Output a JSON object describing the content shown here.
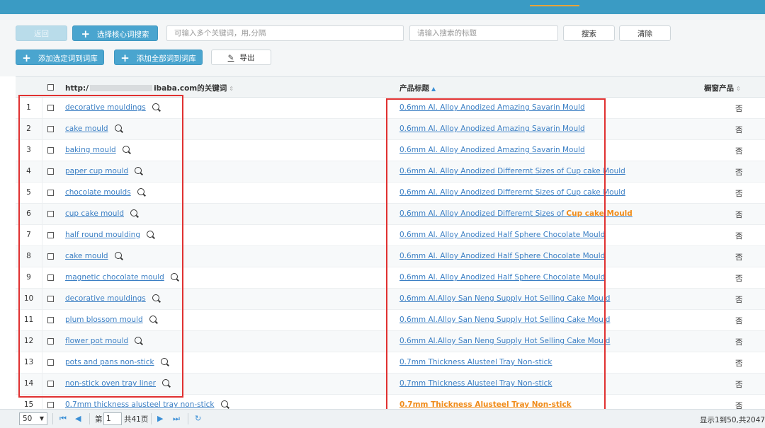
{
  "toolbar": {
    "back_label": "返回",
    "select_core_label": "选择核心词搜索",
    "keyword_placeholder": "可输入多个关键词，用,分隔",
    "title_placeholder": "请输入搜索的标题",
    "search_label": "搜索",
    "clear_label": "清除",
    "add_selected_label": "添加选定词到词库",
    "add_all_label": "添加全部词到词库",
    "export_label": "导出"
  },
  "table": {
    "header_keyword_prefix": "http:/",
    "header_keyword_suffix": "ibaba.com的关键词",
    "header_title": "产品标题",
    "header_showcase": "橱窗产品",
    "sort_neutral": "⇕",
    "sort_asc": "▲",
    "rows": [
      {
        "num": "1",
        "keyword": "decorative mouldings",
        "title": "0.6mm Al. Alloy Anodized Amazing Savarin Mould",
        "title_hl": "",
        "showcase": "否"
      },
      {
        "num": "2",
        "keyword": "cake mould",
        "title": "0.6mm Al. Alloy Anodized Amazing Savarin Mould",
        "title_hl": "",
        "showcase": "否"
      },
      {
        "num": "3",
        "keyword": "baking mould",
        "title": "0.6mm Al. Alloy Anodized Amazing Savarin Mould",
        "title_hl": "",
        "showcase": "否"
      },
      {
        "num": "4",
        "keyword": "paper cup mould",
        "title": "0.6mm Al. Alloy Anodized Differernt Sizes of Cup cake Mould",
        "title_hl": "",
        "showcase": "否"
      },
      {
        "num": "5",
        "keyword": "chocolate moulds",
        "title": "0.6mm Al. Alloy Anodized Differernt Sizes of Cup cake Mould",
        "title_hl": "",
        "showcase": "否"
      },
      {
        "num": "6",
        "keyword": "cup cake mould",
        "title": "0.6mm Al. Alloy Anodized Differernt Sizes of ",
        "title_hl": "Cup cake Mould",
        "showcase": "否"
      },
      {
        "num": "7",
        "keyword": "half round moulding",
        "title": "0.6mm Al. Alloy Anodized Half Sphere Chocolate Mould",
        "title_hl": "",
        "showcase": "否"
      },
      {
        "num": "8",
        "keyword": "cake mould",
        "title": "0.6mm Al. Alloy Anodized Half Sphere Chocolate Mould",
        "title_hl": "",
        "showcase": "否"
      },
      {
        "num": "9",
        "keyword": "magnetic chocolate mould",
        "title": "0.6mm Al. Alloy Anodized Half Sphere Chocolate Mould",
        "title_hl": "",
        "showcase": "否"
      },
      {
        "num": "10",
        "keyword": "decorative mouldings",
        "title": "0.6mm Al.Alloy San Neng Supply Hot Selling Cake Mould",
        "title_hl": "",
        "showcase": "否"
      },
      {
        "num": "11",
        "keyword": "plum blossom mould",
        "title": "0.6mm Al.Alloy San Neng Supply Hot Selling Cake Mould",
        "title_hl": "",
        "showcase": "否"
      },
      {
        "num": "12",
        "keyword": "flower pot mould",
        "title": "0.6mm Al.Alloy San Neng Supply Hot Selling Cake Mould",
        "title_hl": "",
        "showcase": "否"
      },
      {
        "num": "13",
        "keyword": "pots and pans non-stick",
        "title": "0.7mm Thickness Alusteel Tray Non-stick",
        "title_hl": "",
        "showcase": "否"
      },
      {
        "num": "14",
        "keyword": "non-stick oven tray liner",
        "title": "0.7mm Thickness Alusteel Tray Non-stick",
        "title_hl": "",
        "showcase": "否"
      },
      {
        "num": "15",
        "keyword": "0.7mm thickness alusteel tray non-stick",
        "title": "",
        "title_hl": "0.7mm Thickness Alusteel Tray Non-stick",
        "showcase": "否"
      }
    ]
  },
  "pager": {
    "page_size": "50",
    "page_prefix": "第",
    "page_value": "1",
    "page_total": "共41页",
    "info": "显示1到50,共2047记"
  },
  "colors": {
    "accent": "#4aa5cf",
    "link": "#3b7fc4",
    "highlight": "#f08c1b",
    "annotation": "#e03131"
  }
}
